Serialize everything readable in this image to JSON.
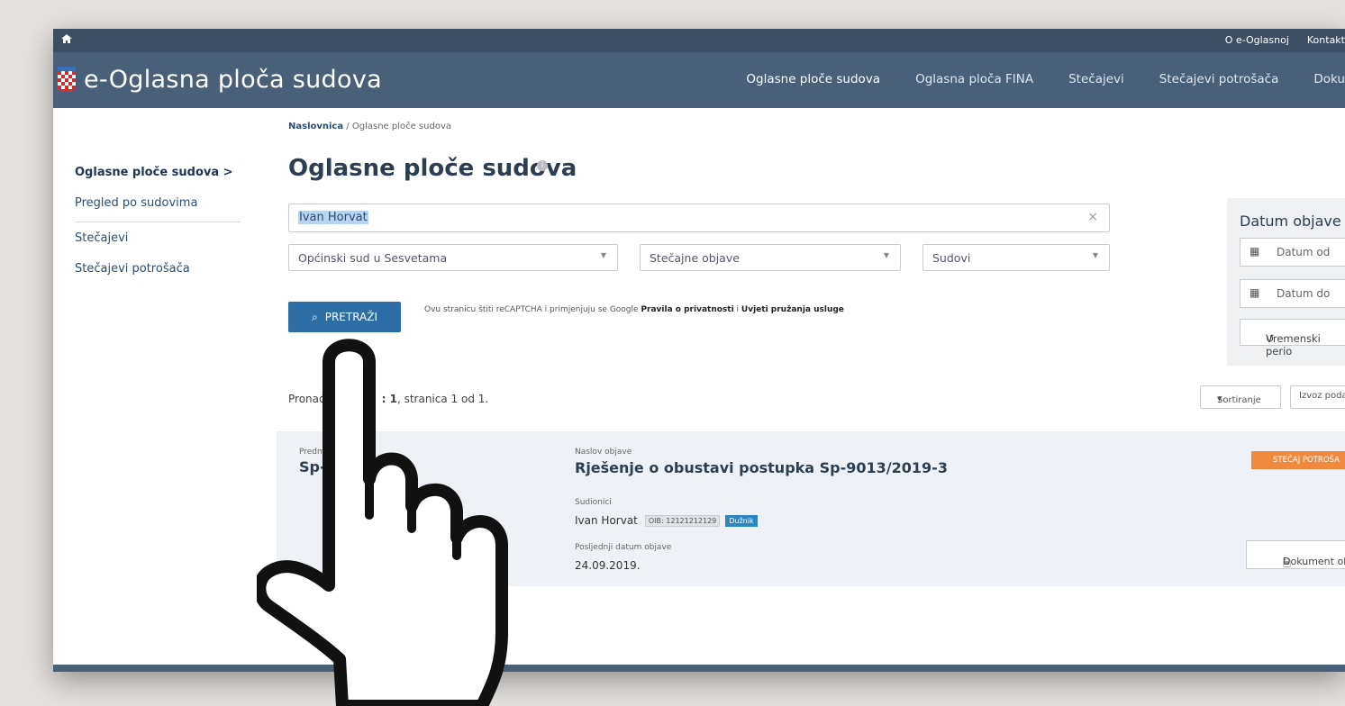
{
  "topbar": {
    "links": [
      "O e-Oglasnoj",
      "Kontakt"
    ]
  },
  "header": {
    "brand": "e-Oglasna ploča sudova",
    "nav": [
      "Oglasne ploče sudova",
      "Oglasna ploča FINA",
      "Stečajevi",
      "Stečajevi potrošača",
      "Doku"
    ]
  },
  "breadcrumb": {
    "home": "Naslovnica",
    "separator": "/",
    "current": "Oglasne ploče sudova"
  },
  "sidebar": {
    "items": [
      "Oglasne ploče sudova >",
      "Pregled po sudovima",
      "Stečajevi",
      "Stečajevi potrošača"
    ]
  },
  "page": {
    "title": "Oglasne ploče sudova"
  },
  "search": {
    "value": "Ivan Horvat",
    "clear": "×",
    "filters": [
      "Općinski sud u Sesvetama",
      "Stečajne objave",
      "Sudovi"
    ],
    "button": "PRETRAŽI",
    "captcha_prefix": "Ovu stranicu štiti reCAPTCHA i primjenjuju se Google",
    "captcha_privacy": "Pravila o privatnosti",
    "captcha_and": "i",
    "captcha_terms": "Uvjeti pružanja usluge"
  },
  "date_filter": {
    "title": "Datum objave",
    "from": "Datum od",
    "to": "Datum do",
    "period": "Vremenski perio"
  },
  "results": {
    "count_prefix": "Pronađ",
    "count_value": ": 1",
    "count_suffix": ", stranica 1 od 1.",
    "sort": "Sortiranje",
    "export": "Izvoz poda"
  },
  "card": {
    "case_label": "Predm",
    "case_no": "Sp-",
    "title_label": "Naslov objave",
    "title": "Rješenje o obustavi postupka Sp-9013/2019-3",
    "parties_label": "Sudionici",
    "party_name": "Ivan Horvat",
    "oib": "OIB: 12121212129",
    "role": "Dužnik",
    "date_label": "Posljednji datum objave",
    "date": "24.09.2019.",
    "badge": "STEČAJ POTROŠA",
    "doc_button": "Dokument obj"
  },
  "colors": {
    "header": "#4a6078",
    "topbar": "#3d4e62",
    "primary": "#2e6ea6",
    "badge": "#f0883e"
  }
}
